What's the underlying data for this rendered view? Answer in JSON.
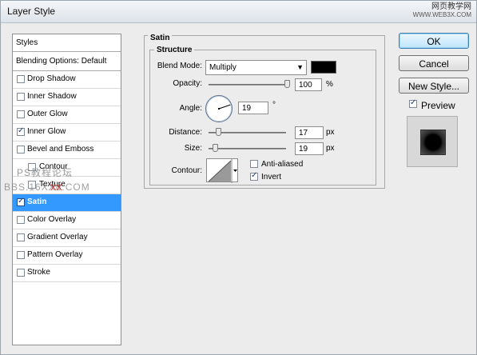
{
  "window": {
    "title": "Layer Style"
  },
  "watermark": {
    "line1": "网页教学网",
    "line2": "WWW.WEB3X.COM",
    "mid1": "PS教程论坛",
    "mid2": "BBS.16XX8.COM",
    "red": "XX"
  },
  "styles": {
    "header": "Styles",
    "blending": "Blending Options: Default",
    "items": [
      {
        "label": "Drop Shadow",
        "checked": false
      },
      {
        "label": "Inner Shadow",
        "checked": false
      },
      {
        "label": "Outer Glow",
        "checked": false
      },
      {
        "label": "Inner Glow",
        "checked": true
      },
      {
        "label": "Bevel and Emboss",
        "checked": false
      },
      {
        "label": "Contour",
        "checked": false
      },
      {
        "label": "Texture",
        "checked": false
      },
      {
        "label": "Satin",
        "checked": true,
        "selected": true
      },
      {
        "label": "Color Overlay",
        "checked": false
      },
      {
        "label": "Gradient Overlay",
        "checked": false
      },
      {
        "label": "Pattern Overlay",
        "checked": false
      },
      {
        "label": "Stroke",
        "checked": false
      }
    ]
  },
  "satin": {
    "group_title": "Satin",
    "structure_title": "Structure",
    "blend_mode_label": "Blend Mode:",
    "blend_mode_value": "Multiply",
    "blend_color": "#000000",
    "opacity_label": "Opacity:",
    "opacity_value": "100",
    "opacity_unit": "%",
    "opacity_fraction": 1.0,
    "angle_label": "Angle:",
    "angle_value": "19",
    "angle_unit": "°",
    "distance_label": "Distance:",
    "distance_value": "17",
    "distance_unit": "px",
    "distance_fraction": 0.12,
    "size_label": "Size:",
    "size_value": "19",
    "size_unit": "px",
    "size_fraction": 0.08,
    "contour_label": "Contour:",
    "anti_aliased_label": "Anti-aliased",
    "anti_aliased_checked": false,
    "invert_label": "Invert",
    "invert_checked": true
  },
  "buttons": {
    "ok": "OK",
    "cancel": "Cancel",
    "new_style": "New Style...",
    "preview_label": "Preview",
    "preview_checked": true
  },
  "colors": {
    "selection": "#3399ff",
    "ok_border": "#3c7fb1"
  }
}
